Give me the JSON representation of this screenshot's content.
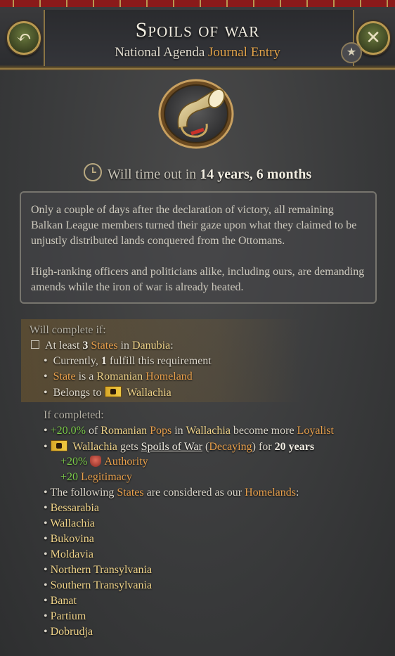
{
  "header": {
    "title": "Spoils of war",
    "subtitle_main": "National Agenda",
    "subtitle_accent": "Journal Entry"
  },
  "timeout": {
    "prefix": "Will time out in",
    "value": "14 years, 6 months"
  },
  "description": {
    "p1": "Only a couple of days after the declaration of victory, all remaining Balkan League members turned their gaze upon what they claimed to be unjustly distributed lands conquered from the Ottomans.",
    "p2": "High-ranking officers and politicians alike, including ours, are demanding amends while the iron of war is already heated."
  },
  "requirements": {
    "header": "Will complete if:",
    "main_prefix": "At least",
    "main_count": "3",
    "main_states": "States",
    "main_in": "in",
    "main_region": "Danubia",
    "currently_prefix": "Currently,",
    "currently_count": "1",
    "currently_suffix": "fulfill this requirement",
    "state_label": "State",
    "state_is_a": "is a",
    "state_culture": "Romanian",
    "state_homeland": "Homeland",
    "belongs_prefix": "Belongs to",
    "belongs_country": "Wallachia"
  },
  "effects": {
    "header": "If completed:",
    "e1_pct": "+20.0%",
    "e1_of": "of",
    "e1_culture": "Romanian",
    "e1_pops": "Pops",
    "e1_in": "in",
    "e1_country": "Wallachia",
    "e1_become": "become more",
    "e1_loyalist": "Loyalist",
    "e2_country": "Wallachia",
    "e2_gets": "gets",
    "e2_modifier": "Spoils of War",
    "e2_decaying": "Decaying",
    "e2_for": "for",
    "e2_years": "20 years",
    "e2_auth_val": "+20%",
    "e2_auth_label": "Authority",
    "e2_leg_val": "+20",
    "e2_leg_label": "Legitimacy",
    "e3_prefix": "The following",
    "e3_states": "States",
    "e3_mid": "are considered as our",
    "e3_homelands": "Homelands",
    "states": [
      "Bessarabia",
      "Wallachia",
      "Bukovina",
      "Moldavia",
      "Northern Transylvania",
      "Southern Transylvania",
      "Banat",
      "Partium",
      "Dobrudja"
    ]
  },
  "icons": {
    "back": "back-arrow-icon",
    "close": "close-icon",
    "star": "star-icon",
    "clock": "clock-icon",
    "emblem": "bugle-horn-icon",
    "flag": "wallachia-flag-icon",
    "authority": "authority-icon"
  },
  "colors": {
    "accent_orange": "#e8a04c",
    "positive_green": "#7ccc4a",
    "header_red": "#8a1a1a",
    "gold_trim": "#b89850"
  }
}
